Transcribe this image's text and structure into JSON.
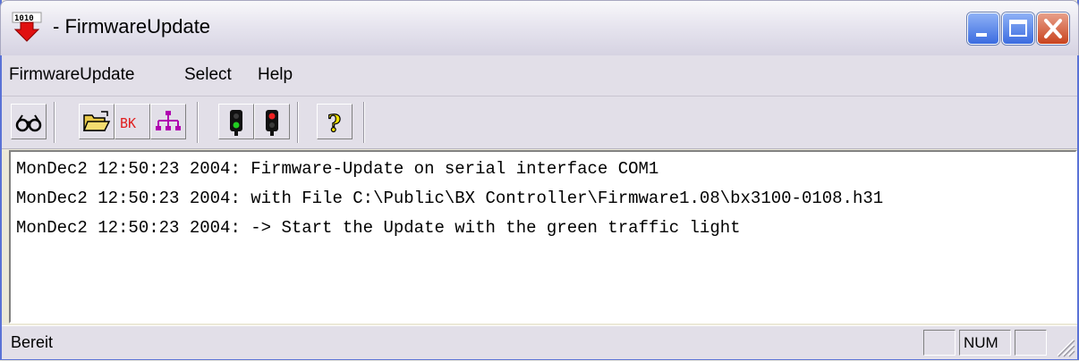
{
  "window": {
    "title": "- FirmwareUpdate",
    "app_icon": "firmware-update-icon",
    "controls": [
      "minimize-icon",
      "maximize-icon",
      "close-icon"
    ]
  },
  "menu": {
    "items": [
      {
        "label": "FirmwareUpdate"
      },
      {
        "label": "Select"
      },
      {
        "label": "Help"
      }
    ]
  },
  "toolbar": {
    "buttons": [
      {
        "icon": "glasses-icon"
      },
      {
        "icon": "open-folder-icon"
      },
      {
        "icon": "bk-icon",
        "label": "BK"
      },
      {
        "icon": "network-icon"
      },
      {
        "icon": "green-traffic-light-icon"
      },
      {
        "icon": "red-traffic-light-icon"
      },
      {
        "icon": "help-icon"
      }
    ]
  },
  "log": {
    "lines": [
      "MonDec2 12:50:23 2004: Firmware-Update on serial interface COM1",
      "MonDec2 12:50:23 2004: with File C:\\Public\\BX Controller\\Firmware1.08\\bx3100-0108.h31",
      "MonDec2 12:50:23 2004: -> Start the Update with the green traffic light"
    ]
  },
  "status": {
    "text": "Bereit",
    "pane_num": "NUM",
    "pane_blank_1": "",
    "pane_blank_2": ""
  },
  "colors": {
    "titlebar_text": "#000000",
    "close_button": "#c9431e",
    "window_frame": "#5a72d6",
    "chrome_bg": "#e2dfe8",
    "traffic_green": "#22aa22",
    "traffic_red": "#dd2222",
    "bk_red": "#e02020",
    "network_purple": "#b000b0"
  }
}
